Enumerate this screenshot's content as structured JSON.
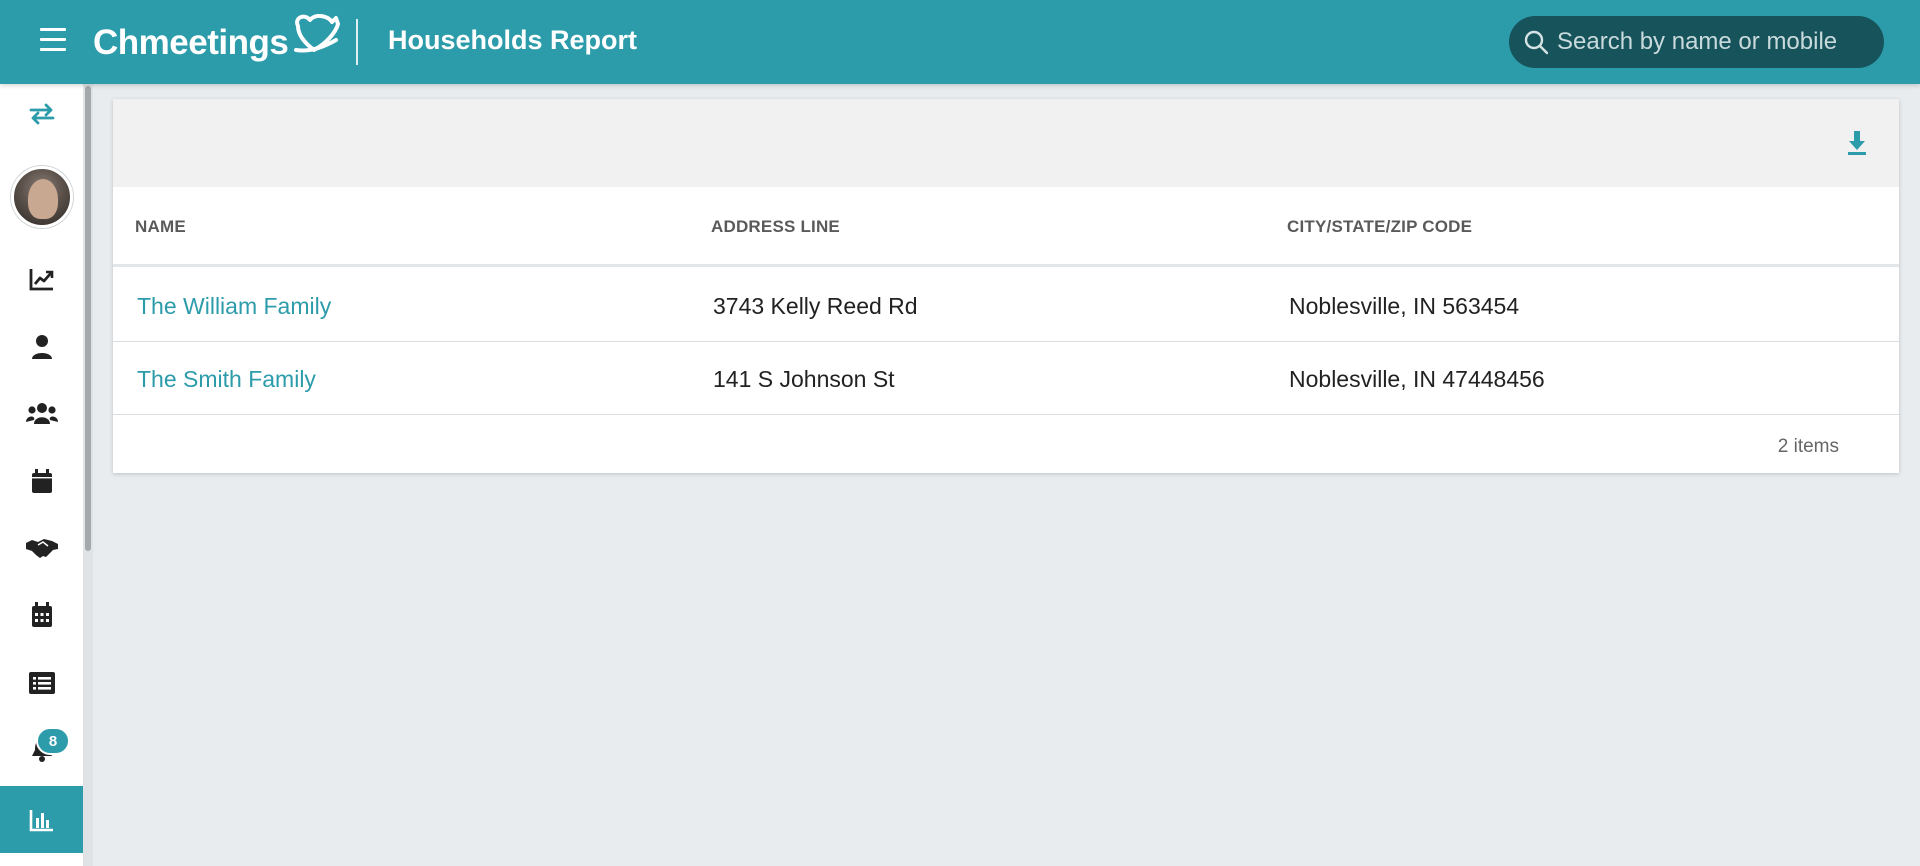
{
  "app": {
    "brand": "Chmeetings",
    "page_title": "Households Report"
  },
  "search": {
    "placeholder": "Search by name or mobile"
  },
  "sidebar": {
    "items": [
      {
        "name": "swap-icon"
      },
      {
        "name": "avatar"
      },
      {
        "name": "chart-line-icon"
      },
      {
        "name": "person-icon"
      },
      {
        "name": "group-icon"
      },
      {
        "name": "calendar-icon"
      },
      {
        "name": "handshake-icon"
      },
      {
        "name": "calendar-grid-icon"
      },
      {
        "name": "list-icon"
      },
      {
        "name": "bell-icon"
      },
      {
        "name": "report-icon"
      }
    ],
    "notification_count": "8"
  },
  "table": {
    "columns": [
      "NAME",
      "ADDRESS LINE",
      "CITY/STATE/ZIP CODE"
    ],
    "rows": [
      {
        "name": "The William Family",
        "address": "3743 Kelly Reed Rd",
        "city": "Noblesville, IN 563454"
      },
      {
        "name": "The Smith Family",
        "address": "141 S Johnson St",
        "city": "Noblesville, IN 47448456"
      }
    ],
    "count_label": "2 items"
  },
  "colors": {
    "accent": "#2c9cab",
    "search_bg": "#16535b",
    "page_bg": "#e8ecee"
  }
}
